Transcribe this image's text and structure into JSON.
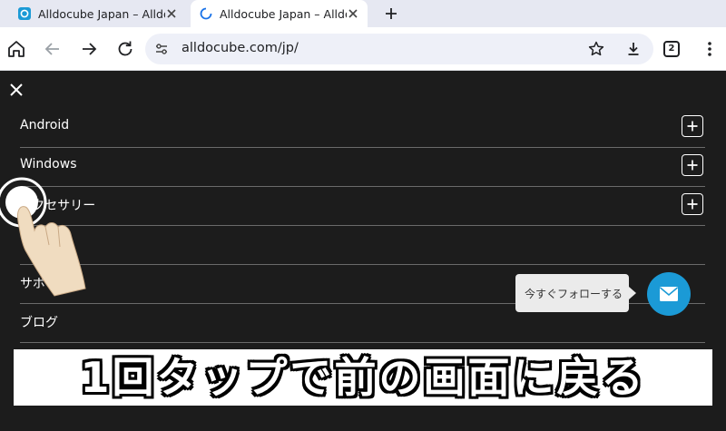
{
  "browser": {
    "tabs": [
      {
        "title": "Alldocube Japan – Alldocub",
        "state": "loaded"
      },
      {
        "title": "Alldocube Japan – Alldocub",
        "state": "loading"
      }
    ],
    "url": "alldocube.com/jp/",
    "tab_count": "2"
  },
  "page": {
    "menu_items": [
      {
        "label": "Android",
        "expandable": true
      },
      {
        "label": "Windows",
        "expandable": true
      },
      {
        "label": "アクセサリー",
        "expandable": true
      },
      {
        "label": "",
        "expandable": false
      },
      {
        "label": "サポート",
        "expandable": false
      },
      {
        "label": "ブログ",
        "expandable": false
      }
    ],
    "follow_tooltip": "今すぐフォローする"
  },
  "overlay": {
    "caption": "1回タップで前の画面に戻る"
  },
  "colors": {
    "page_bg": "#1c1c1c",
    "accent": "#1b9ad6",
    "tabstrip_bg": "#e6e8f2"
  }
}
